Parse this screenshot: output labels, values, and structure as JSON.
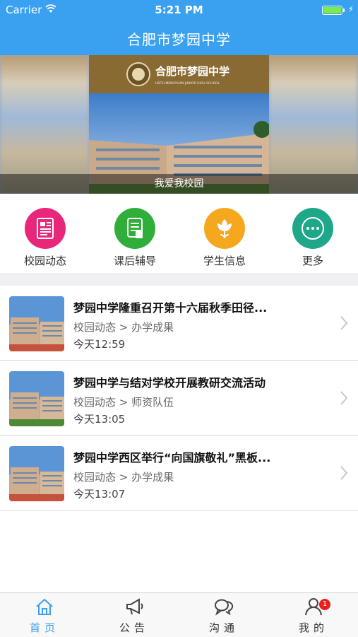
{
  "status_bar": {
    "carrier": "Carrier",
    "time": "5:21 PM"
  },
  "nav": {
    "title": "合肥市梦园中学"
  },
  "banner": {
    "school_name": "合肥市梦园中学",
    "school_name_en": "HEFEI MENGYUAN JUNIOR HIGH SCHOOL",
    "caption": "我爱我校园"
  },
  "menu": [
    {
      "label": "校园动态",
      "icon": "newspaper-icon",
      "color": "#e8277a"
    },
    {
      "label": "课后辅导",
      "icon": "document-icon",
      "color": "#2fae3a"
    },
    {
      "label": "学生信息",
      "icon": "flower-icon",
      "color": "#f5a81e"
    },
    {
      "label": "更多",
      "icon": "more-icon",
      "color": "#1fa78a"
    }
  ],
  "news": [
    {
      "title": "梦园中学隆重召开第十六届秋季田径...",
      "category": "校园动态 > 办学成果",
      "time": "今天12:59"
    },
    {
      "title": "梦园中学与结对学校开展教研交流活动",
      "category": "校园动态 > 师资队伍",
      "time": "今天13:05"
    },
    {
      "title": "梦园中学西区举行“向国旗敬礼”黑板...",
      "category": "校园动态 > 办学成果",
      "time": "今天13:07"
    }
  ],
  "tabs": [
    {
      "label": "首页",
      "icon": "home-icon",
      "active": true
    },
    {
      "label": "公告",
      "icon": "megaphone-icon"
    },
    {
      "label": "沟通",
      "icon": "chat-icon"
    },
    {
      "label": "我的",
      "icon": "person-icon",
      "badge": "1"
    }
  ],
  "colors": {
    "accent": "#3aa0f0",
    "badge": "#e8201c"
  }
}
